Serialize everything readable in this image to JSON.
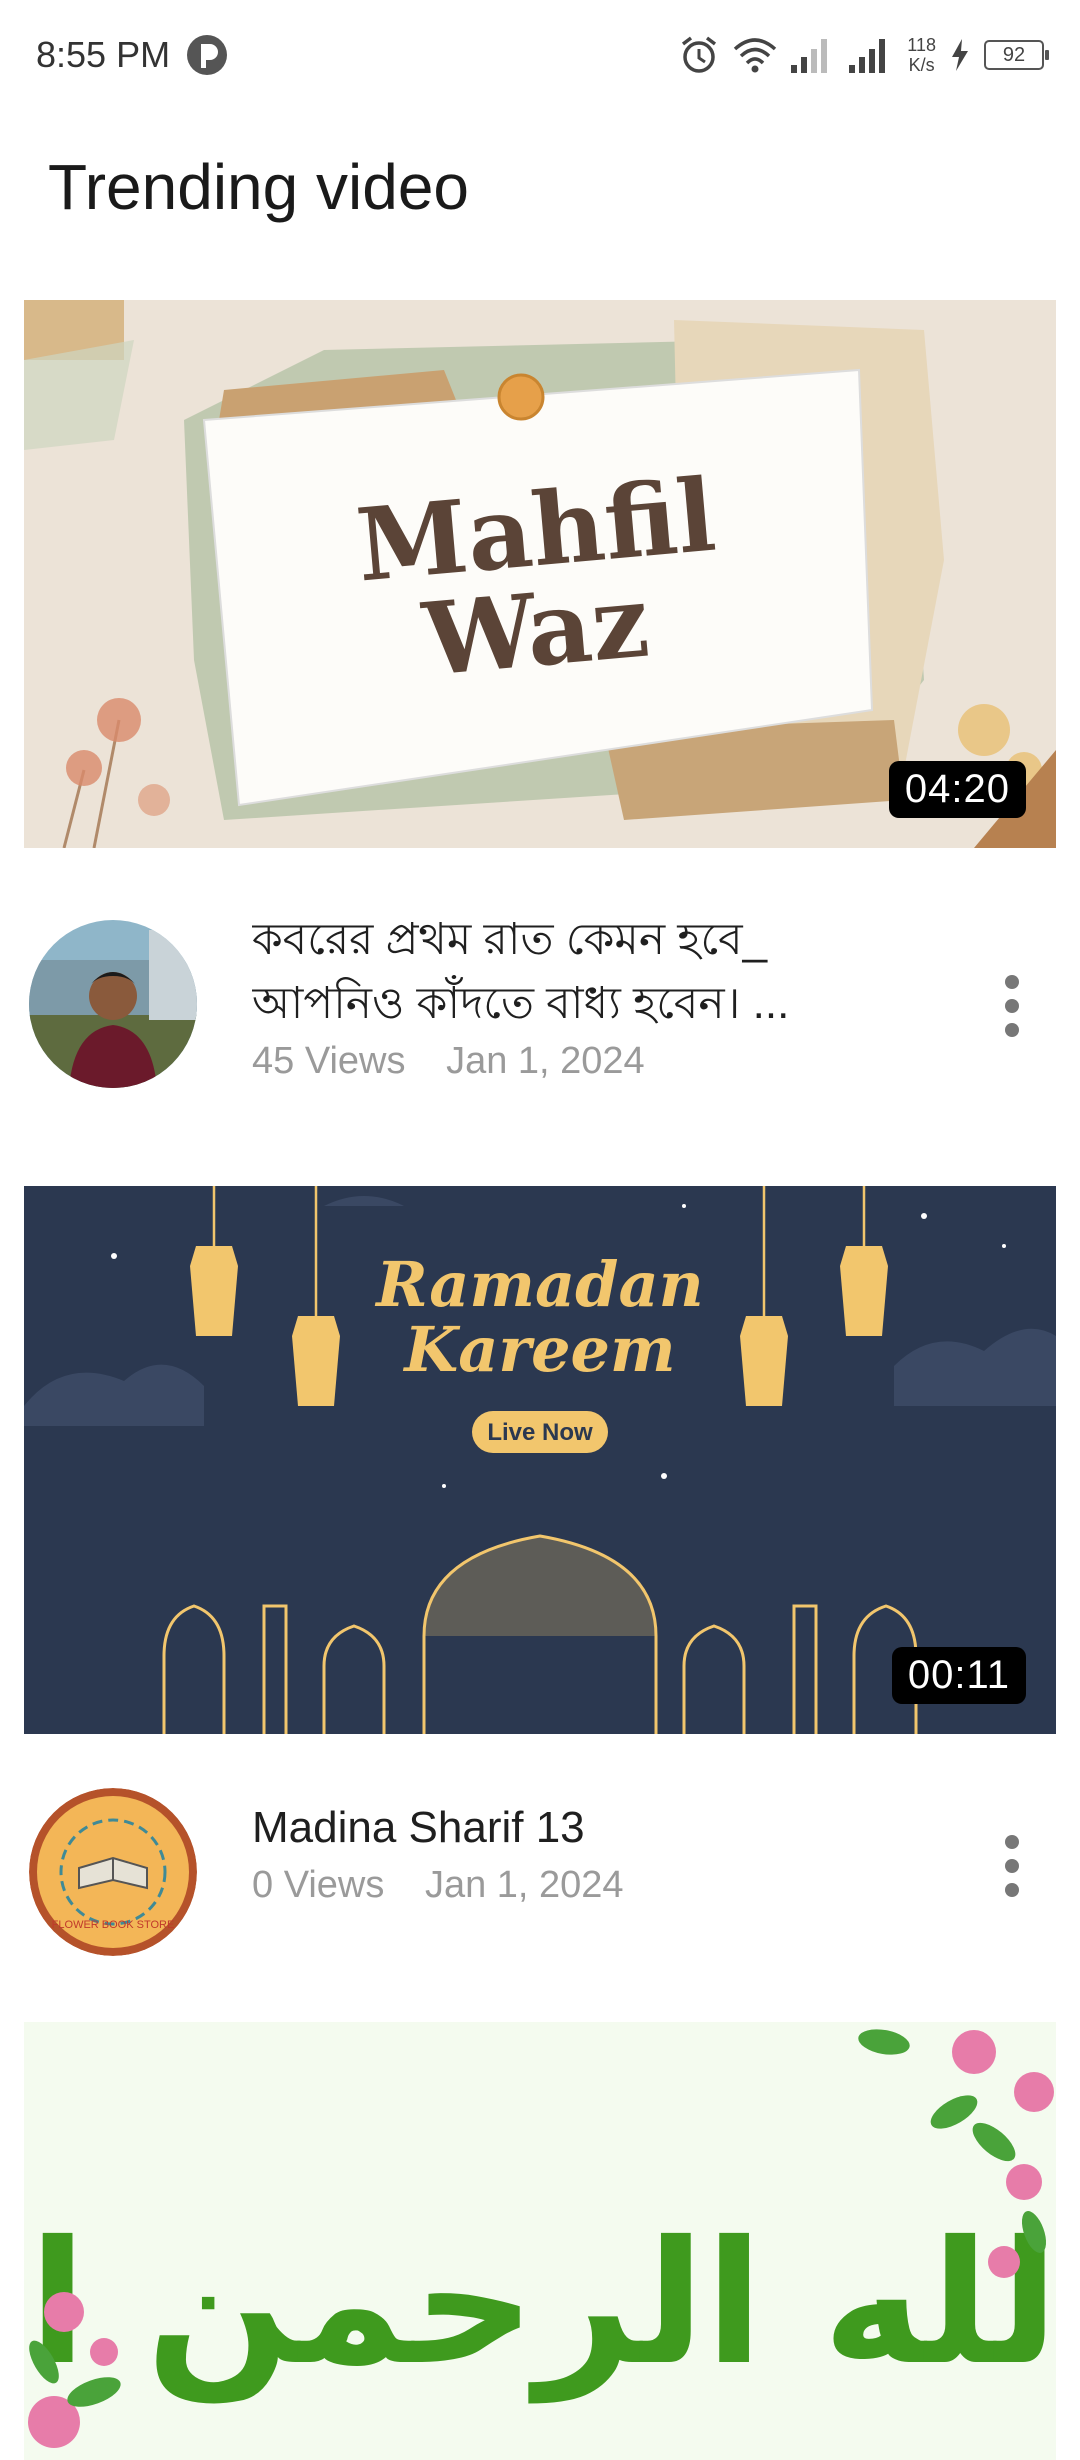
{
  "status_bar": {
    "time": "8:55 PM",
    "net_speed_value": "118",
    "net_speed_unit": "K/s",
    "battery": "92"
  },
  "page": {
    "title": "Trending video"
  },
  "videos": [
    {
      "thumbnail_text": [
        "Mahfil",
        "Waz"
      ],
      "duration": "04:20",
      "title": "কবরের প্রথম রাত কেমন হবে_ আপনিও কাঁদতে বাধ্য হবেন। ...",
      "views": "45 Views",
      "date": "Jan 1, 2024"
    },
    {
      "thumbnail_text": [
        "Ramadan",
        "Kareem",
        "Live Now"
      ],
      "duration": "00:11",
      "title": "Madina Sharif 13",
      "views": "0 Views",
      "date": "Jan 1, 2024",
      "avatar_text": "FLOWER BOOK STORE"
    },
    {
      "thumbnail_text": [
        "بسم الله الرحمن الرحيم"
      ]
    }
  ],
  "colors": {
    "ramadan_bg": "#2b3850",
    "ramadan_gold": "#f2c66d",
    "calligraphy_green": "#3f9a1e",
    "duration_bg": "#000000"
  }
}
